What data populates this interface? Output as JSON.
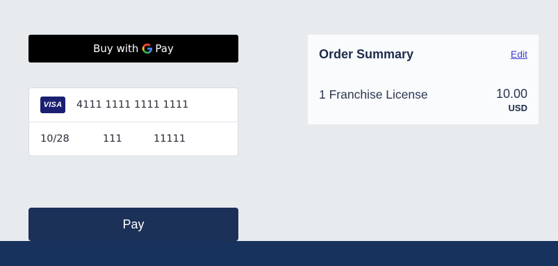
{
  "gpay": {
    "buy_label": "Buy with",
    "pay_label": "Pay",
    "icon": "google-g-icon"
  },
  "card": {
    "brand": "VISA",
    "brand_icon": "visa-card-icon",
    "number": "4111 1111 1111 1111",
    "expiry": "10/28",
    "cvc": "111",
    "zip": "11111"
  },
  "pay_button": {
    "label": "Pay"
  },
  "order_summary": {
    "title": "Order Summary",
    "edit_label": "Edit",
    "items": [
      {
        "name": "1 Franchise License",
        "amount": "10.00",
        "currency": "USD"
      }
    ]
  },
  "colors": {
    "background": "#e8ebee",
    "pay_button": "#1c3158",
    "footer": "#17325c",
    "link": "#3b3bd1"
  }
}
